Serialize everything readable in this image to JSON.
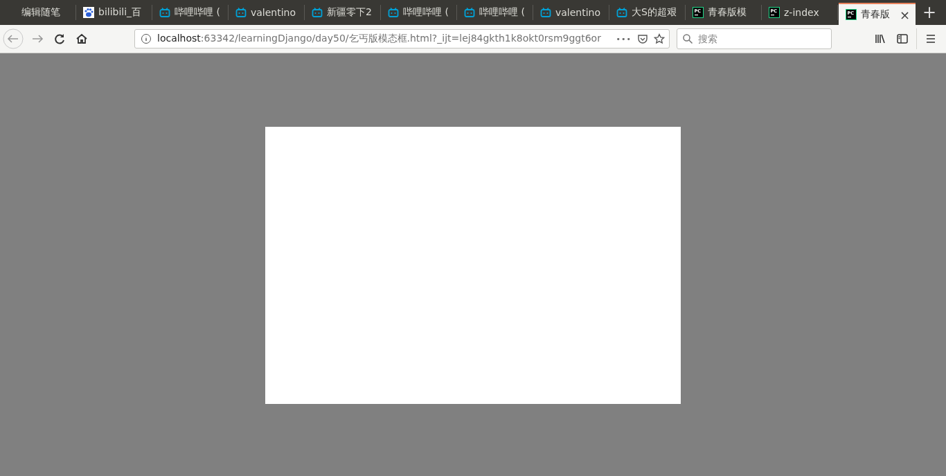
{
  "tabs": [
    {
      "title": "编辑随笔",
      "kind": "plain",
      "selected": false
    },
    {
      "title": "bilibili_百",
      "kind": "paw",
      "selected": false
    },
    {
      "title": "哔哩哔哩 (",
      "kind": "tv",
      "selected": false
    },
    {
      "title": "valentino",
      "kind": "tv",
      "selected": false
    },
    {
      "title": "新疆零下2",
      "kind": "tv",
      "selected": false
    },
    {
      "title": "哔哩哔哩 (",
      "kind": "tv",
      "selected": false
    },
    {
      "title": "哔哩哔哩 (",
      "kind": "tv",
      "selected": false
    },
    {
      "title": "valentino",
      "kind": "tv",
      "selected": false
    },
    {
      "title": "大S的超艰",
      "kind": "tv",
      "selected": false
    },
    {
      "title": "青春版模",
      "kind": "pc",
      "badge": "PC",
      "selected": false
    },
    {
      "title": "z-index",
      "kind": "pc",
      "badge": "PC",
      "selected": false
    },
    {
      "title": "青春版",
      "kind": "pc",
      "badge": "PC",
      "selected": true
    }
  ],
  "close_tab": "×",
  "new_tab": "+",
  "address": {
    "host": "localhost",
    "rest": ":63342/learningDjango/day50/乞丐版模态框.html?_ijt=lej84gkth1k8okt0rsm9ggt6or",
    "more": "•••"
  },
  "search": {
    "placeholder": "搜索"
  },
  "modal": {
    "kind": "blank"
  }
}
